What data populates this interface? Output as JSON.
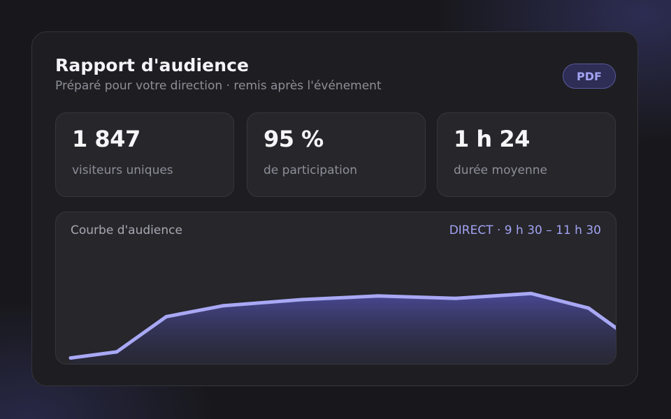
{
  "header": {
    "title": "Rapport d'audience",
    "subtitle": "Préparé pour votre direction · remis après l'événement",
    "pdf_label": "PDF"
  },
  "stats": [
    {
      "value": "1 847",
      "label": "visiteurs uniques"
    },
    {
      "value": "95 %",
      "label": "de participation"
    },
    {
      "value": "1 h 24",
      "label": "durée moyenne"
    }
  ],
  "chart": {
    "title": "Courbe d'audience",
    "badge": "DIRECT · 9 h 30 – 11 h 30"
  },
  "colors": {
    "accent": "#a3a3f4",
    "line": "#a8a8f5",
    "fill": "#4a4a9a"
  },
  "chart_data": {
    "type": "area",
    "title": "Courbe d'audience",
    "xlabel": "",
    "ylabel": "",
    "x": [
      0,
      1,
      2,
      3,
      4,
      5,
      6,
      7,
      8,
      9
    ],
    "values": [
      6,
      11,
      40,
      49,
      54,
      57,
      55,
      59,
      47,
      30
    ],
    "ylim": [
      0,
      100
    ],
    "grid": false
  }
}
